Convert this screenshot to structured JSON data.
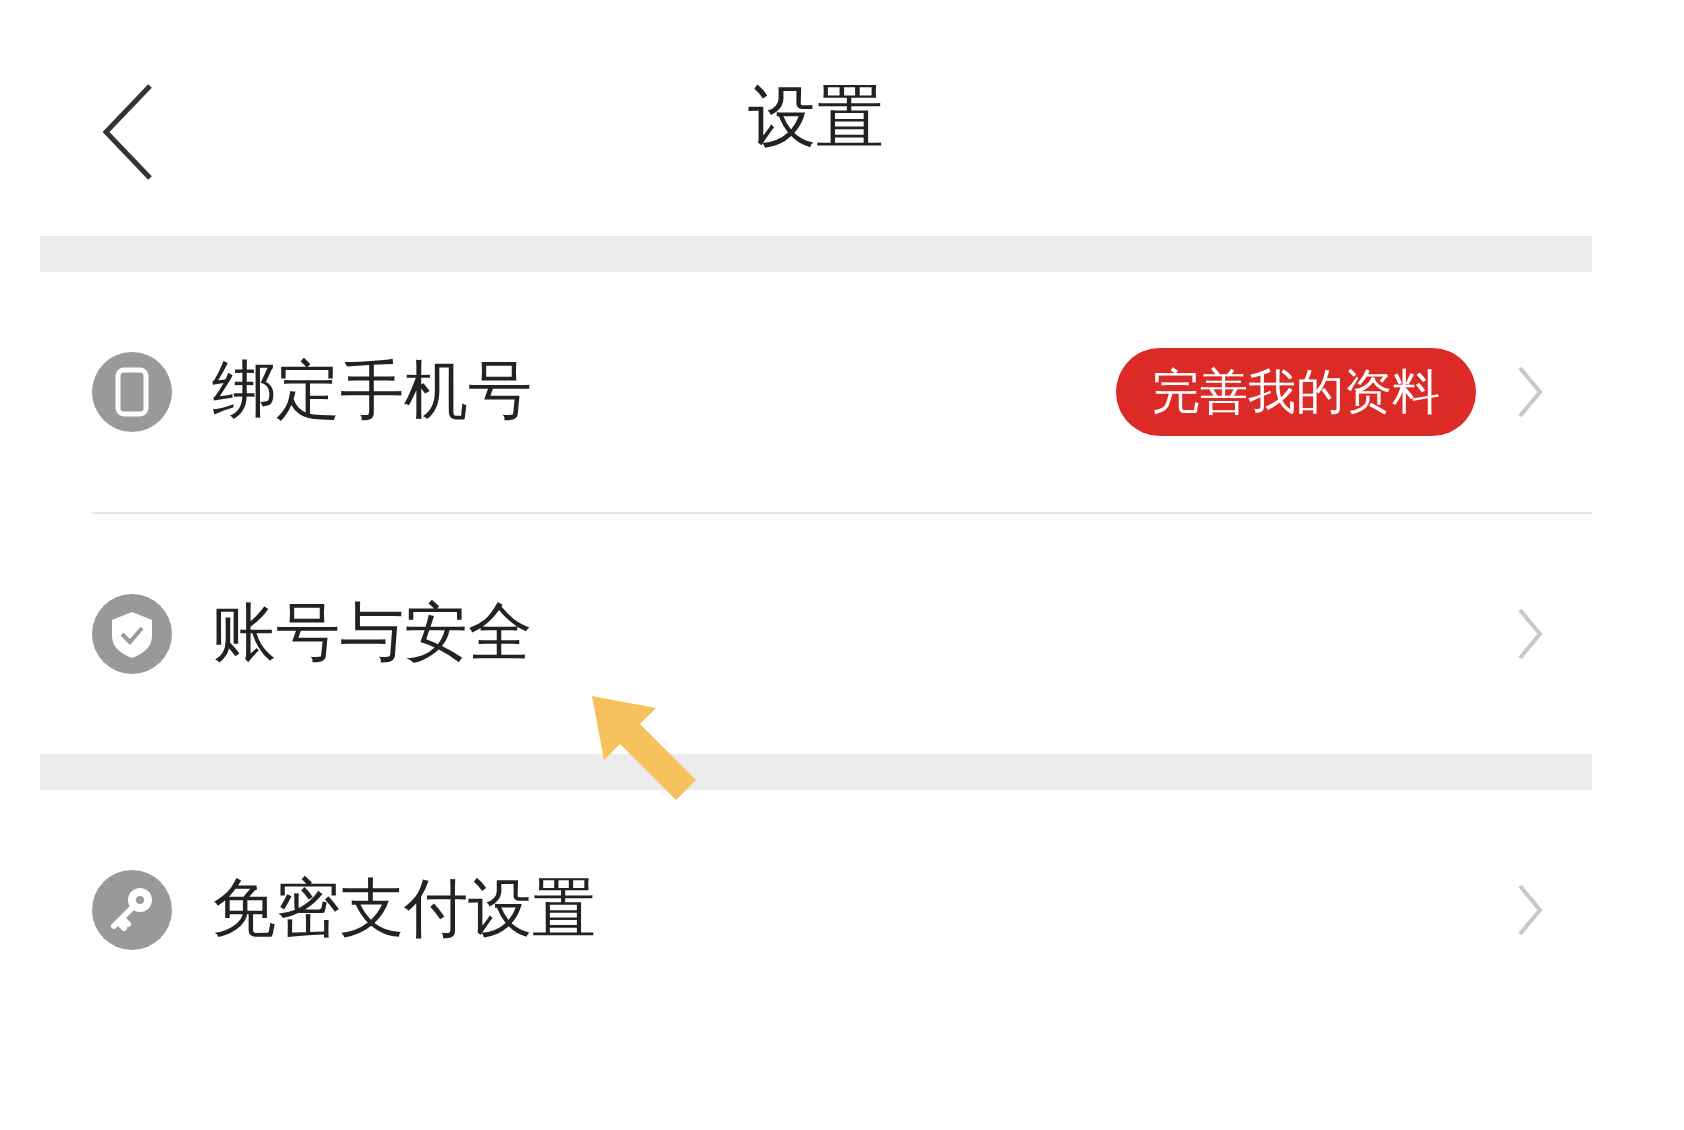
{
  "header": {
    "title": "设置"
  },
  "sections": [
    {
      "items": [
        {
          "kind": "phone",
          "label": "绑定手机号",
          "badge": "完善我的资料"
        },
        {
          "kind": "shield",
          "label": "账号与安全"
        }
      ]
    },
    {
      "items": [
        {
          "kind": "key",
          "label": "免密支付设置"
        }
      ]
    }
  ]
}
